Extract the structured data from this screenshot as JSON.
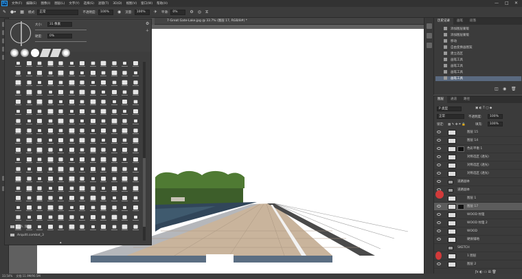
{
  "menubar": {
    "logo": "Ps",
    "items": [
      "文件(F)",
      "编辑(E)",
      "图像(I)",
      "图层(L)",
      "文字(Y)",
      "选择(S)",
      "滤镜(T)",
      "3D(D)",
      "视图(V)",
      "窗口(W)",
      "帮助(H)"
    ]
  },
  "options": {
    "mode_label": "模式:",
    "mode_value": "正常",
    "opacity_label": "不透明度:",
    "opacity_value": "100%",
    "flow_label": "流量:",
    "flow_value": "100%",
    "smooth_label": "平滑:",
    "smooth_value": "0%"
  },
  "document": {
    "tab_label": "7-Great Gate-Lake.jpg @ 33.7% (图层 17, RGB/8#) *"
  },
  "brush_panel": {
    "size_label": "大小:",
    "size_value": "31 像素",
    "hardness_label": "硬度:",
    "hardness_value": "0%",
    "folders": [
      "楼人 涂鸦",
      "Arquitt.combat_3"
    ]
  },
  "history_panel": {
    "tabs": [
      "历史记录",
      "画笔",
      "段落"
    ],
    "items": [
      "添加图层蒙版",
      "添加图层蒙版",
      "移动",
      "自由变换画图案",
      "建立选区",
      "画笔工具",
      "画笔工具",
      "画笔工具",
      "画笔工具"
    ]
  },
  "layers_panel": {
    "tabs": [
      "图层",
      "通道",
      "路径"
    ],
    "kind_label": "P 类型",
    "blend_mode": "正常",
    "opacity_label": "不透明度:",
    "opacity_value": "100%",
    "lock_label": "锁定:",
    "fill_label": "填充:",
    "fill_value": "100%",
    "layers": [
      "图层 15",
      "图层 14",
      "色彩平衡 1",
      "对称选区 (透光)",
      "对称选区 (透光)",
      "对称选区 (透光)",
      "道路副本",
      "道路副本",
      "图层 1",
      "图层 17",
      "WOOD 纹理",
      "WOOD 纹理 2",
      "WOOD",
      "硬质铺地",
      "SKETCH",
      "1 图层",
      "图层 2"
    ]
  },
  "status": {
    "zoom": "33.54%",
    "doc_info": "文档:11.9M/90.5M"
  },
  "colors": {
    "accent": "#31a8ff",
    "selection": "#5a6a80",
    "annotation_red": "#d13a3a"
  }
}
